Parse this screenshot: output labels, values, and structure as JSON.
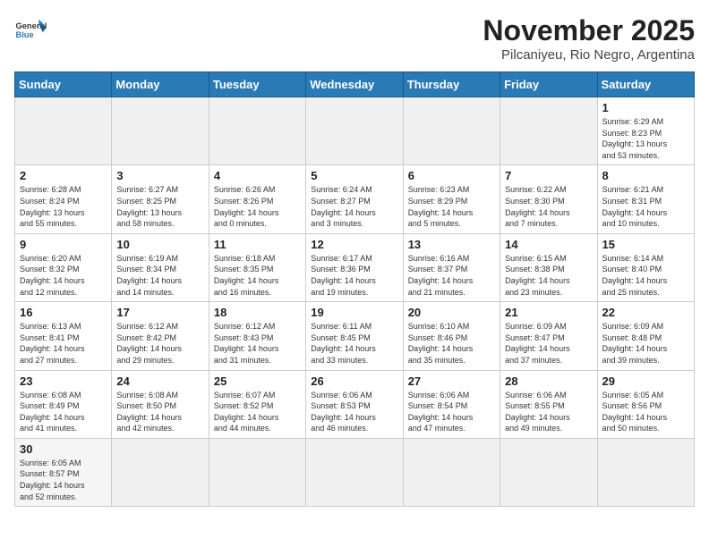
{
  "header": {
    "logo_line1": "General",
    "logo_line2": "Blue",
    "month": "November 2025",
    "location": "Pilcaniyeu, Rio Negro, Argentina"
  },
  "weekdays": [
    "Sunday",
    "Monday",
    "Tuesday",
    "Wednesday",
    "Thursday",
    "Friday",
    "Saturday"
  ],
  "weeks": [
    [
      {
        "day": "",
        "info": ""
      },
      {
        "day": "",
        "info": ""
      },
      {
        "day": "",
        "info": ""
      },
      {
        "day": "",
        "info": ""
      },
      {
        "day": "",
        "info": ""
      },
      {
        "day": "",
        "info": ""
      },
      {
        "day": "1",
        "info": "Sunrise: 6:29 AM\nSunset: 8:23 PM\nDaylight: 13 hours\nand 53 minutes."
      }
    ],
    [
      {
        "day": "2",
        "info": "Sunrise: 6:28 AM\nSunset: 8:24 PM\nDaylight: 13 hours\nand 55 minutes."
      },
      {
        "day": "3",
        "info": "Sunrise: 6:27 AM\nSunset: 8:25 PM\nDaylight: 13 hours\nand 58 minutes."
      },
      {
        "day": "4",
        "info": "Sunrise: 6:26 AM\nSunset: 8:26 PM\nDaylight: 14 hours\nand 0 minutes."
      },
      {
        "day": "5",
        "info": "Sunrise: 6:24 AM\nSunset: 8:27 PM\nDaylight: 14 hours\nand 3 minutes."
      },
      {
        "day": "6",
        "info": "Sunrise: 6:23 AM\nSunset: 8:29 PM\nDaylight: 14 hours\nand 5 minutes."
      },
      {
        "day": "7",
        "info": "Sunrise: 6:22 AM\nSunset: 8:30 PM\nDaylight: 14 hours\nand 7 minutes."
      },
      {
        "day": "8",
        "info": "Sunrise: 6:21 AM\nSunset: 8:31 PM\nDaylight: 14 hours\nand 10 minutes."
      }
    ],
    [
      {
        "day": "9",
        "info": "Sunrise: 6:20 AM\nSunset: 8:32 PM\nDaylight: 14 hours\nand 12 minutes."
      },
      {
        "day": "10",
        "info": "Sunrise: 6:19 AM\nSunset: 8:34 PM\nDaylight: 14 hours\nand 14 minutes."
      },
      {
        "day": "11",
        "info": "Sunrise: 6:18 AM\nSunset: 8:35 PM\nDaylight: 14 hours\nand 16 minutes."
      },
      {
        "day": "12",
        "info": "Sunrise: 6:17 AM\nSunset: 8:36 PM\nDaylight: 14 hours\nand 19 minutes."
      },
      {
        "day": "13",
        "info": "Sunrise: 6:16 AM\nSunset: 8:37 PM\nDaylight: 14 hours\nand 21 minutes."
      },
      {
        "day": "14",
        "info": "Sunrise: 6:15 AM\nSunset: 8:38 PM\nDaylight: 14 hours\nand 23 minutes."
      },
      {
        "day": "15",
        "info": "Sunrise: 6:14 AM\nSunset: 8:40 PM\nDaylight: 14 hours\nand 25 minutes."
      }
    ],
    [
      {
        "day": "16",
        "info": "Sunrise: 6:13 AM\nSunset: 8:41 PM\nDaylight: 14 hours\nand 27 minutes."
      },
      {
        "day": "17",
        "info": "Sunrise: 6:12 AM\nSunset: 8:42 PM\nDaylight: 14 hours\nand 29 minutes."
      },
      {
        "day": "18",
        "info": "Sunrise: 6:12 AM\nSunset: 8:43 PM\nDaylight: 14 hours\nand 31 minutes."
      },
      {
        "day": "19",
        "info": "Sunrise: 6:11 AM\nSunset: 8:45 PM\nDaylight: 14 hours\nand 33 minutes."
      },
      {
        "day": "20",
        "info": "Sunrise: 6:10 AM\nSunset: 8:46 PM\nDaylight: 14 hours\nand 35 minutes."
      },
      {
        "day": "21",
        "info": "Sunrise: 6:09 AM\nSunset: 8:47 PM\nDaylight: 14 hours\nand 37 minutes."
      },
      {
        "day": "22",
        "info": "Sunrise: 6:09 AM\nSunset: 8:48 PM\nDaylight: 14 hours\nand 39 minutes."
      }
    ],
    [
      {
        "day": "23",
        "info": "Sunrise: 6:08 AM\nSunset: 8:49 PM\nDaylight: 14 hours\nand 41 minutes."
      },
      {
        "day": "24",
        "info": "Sunrise: 6:08 AM\nSunset: 8:50 PM\nDaylight: 14 hours\nand 42 minutes."
      },
      {
        "day": "25",
        "info": "Sunrise: 6:07 AM\nSunset: 8:52 PM\nDaylight: 14 hours\nand 44 minutes."
      },
      {
        "day": "26",
        "info": "Sunrise: 6:06 AM\nSunset: 8:53 PM\nDaylight: 14 hours\nand 46 minutes."
      },
      {
        "day": "27",
        "info": "Sunrise: 6:06 AM\nSunset: 8:54 PM\nDaylight: 14 hours\nand 47 minutes."
      },
      {
        "day": "28",
        "info": "Sunrise: 6:06 AM\nSunset: 8:55 PM\nDaylight: 14 hours\nand 49 minutes."
      },
      {
        "day": "29",
        "info": "Sunrise: 6:05 AM\nSunset: 8:56 PM\nDaylight: 14 hours\nand 50 minutes."
      }
    ],
    [
      {
        "day": "30",
        "info": "Sunrise: 6:05 AM\nSunset: 8:57 PM\nDaylight: 14 hours\nand 52 minutes."
      },
      {
        "day": "",
        "info": ""
      },
      {
        "day": "",
        "info": ""
      },
      {
        "day": "",
        "info": ""
      },
      {
        "day": "",
        "info": ""
      },
      {
        "day": "",
        "info": ""
      },
      {
        "day": "",
        "info": ""
      }
    ]
  ]
}
